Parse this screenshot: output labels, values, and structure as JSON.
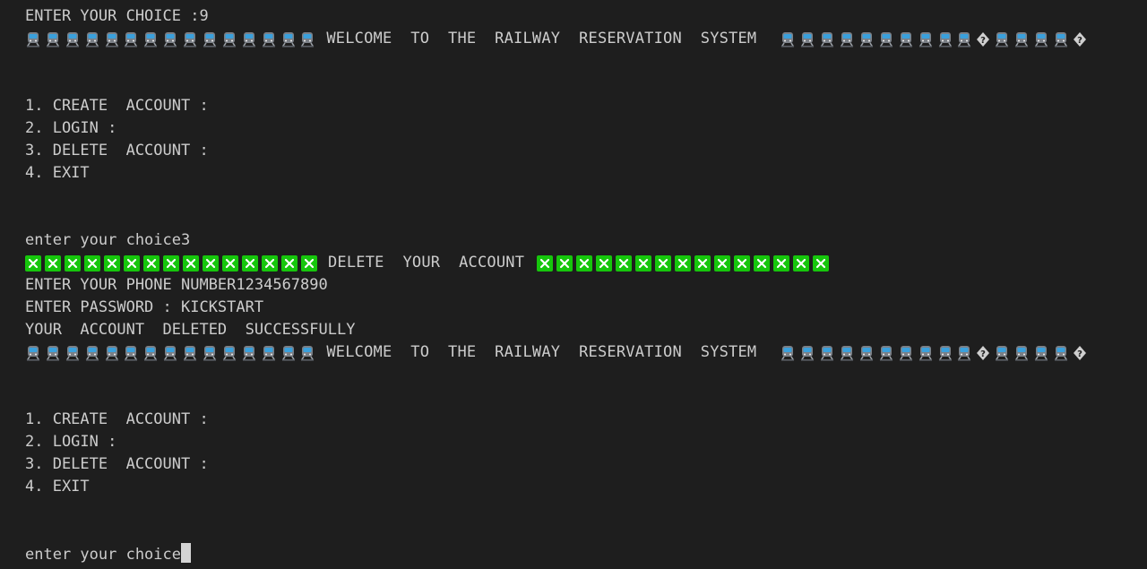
{
  "terminal": {
    "lines": {
      "choice_prev": "ENTER YOUR CHOICE :9",
      "welcome_1": "WELCOME  TO  THE  RAILWAY  RESERVATION  SYSTEM",
      "menu_1_create": "1. CREATE  ACCOUNT :",
      "menu_1_login": "2. LOGIN :",
      "menu_1_delete": "3. DELETE  ACCOUNT :",
      "menu_1_exit": "4. EXIT",
      "choice_3": "enter your choice3",
      "delete_banner": "DELETE  YOUR  ACCOUNT",
      "phone_prompt": "ENTER YOUR PHONE NUMBER1234567890",
      "password_prompt": "ENTER PASSWORD : KICKSTART",
      "deleted_msg": "YOUR  ACCOUNT  DELETED  SUCCESSFULLY",
      "welcome_2": "WELCOME  TO  THE  RAILWAY  RESERVATION  SYSTEM",
      "menu_2_create": "1. CREATE  ACCOUNT :",
      "menu_2_login": "2. LOGIN :",
      "menu_2_delete": "3. DELETE  ACCOUNT :",
      "menu_2_exit": "4. EXIT",
      "choice_prompt": "enter your choice"
    },
    "icons": {
      "train": "train-icon",
      "replacement": "replacement-char-icon",
      "cross": "cross-mark-icon"
    },
    "colors": {
      "background": "#1e1e1e",
      "text": "#cccccc",
      "cross_green": "#16c60c",
      "train_blue": "#3aa0dc"
    }
  }
}
